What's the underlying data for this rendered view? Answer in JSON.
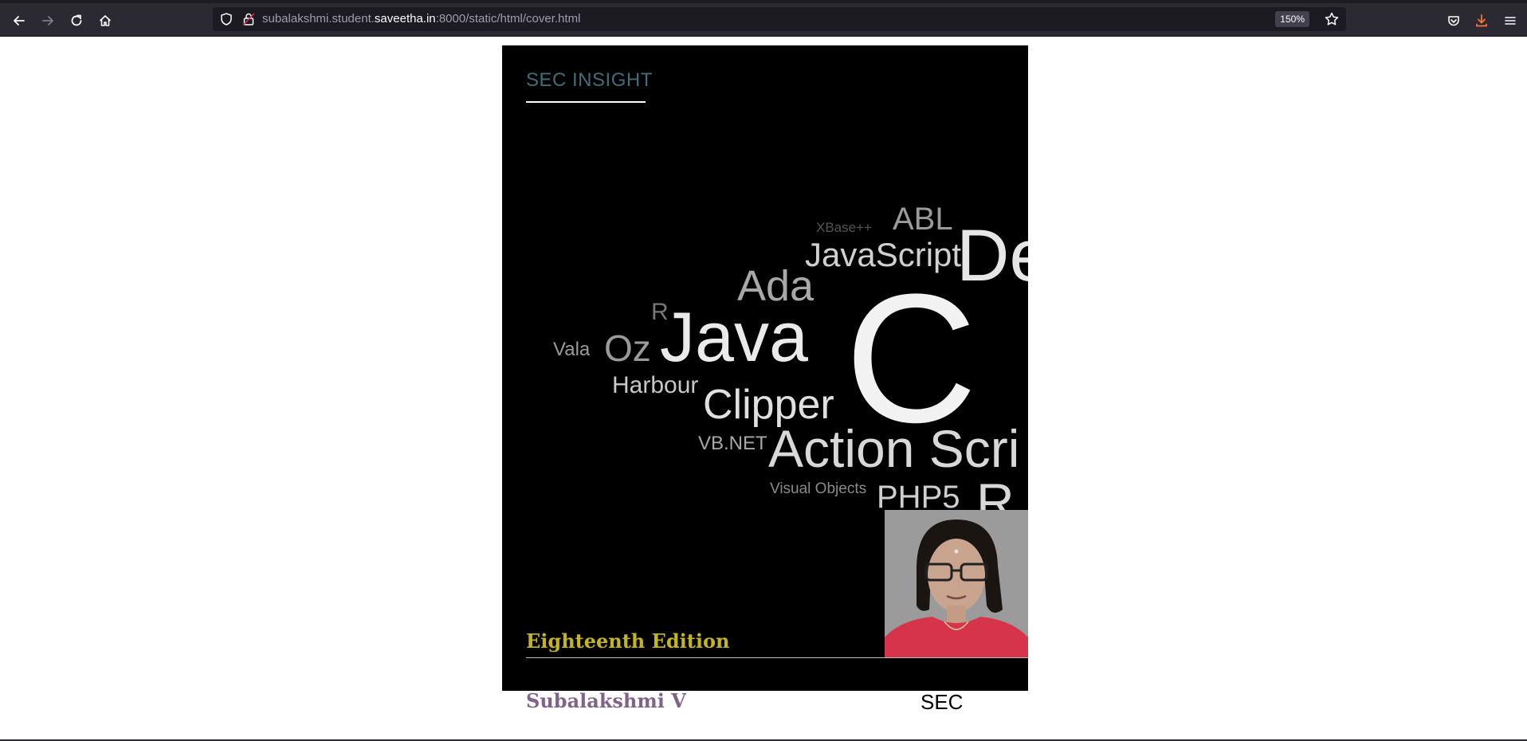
{
  "browser": {
    "url_prefix": "subalakshmi.student.",
    "url_domain": "saveetha.in",
    "url_suffix": ":8000/static/html/cover.html",
    "zoom": "150%",
    "icons": [
      "back-arrow-icon",
      "forward-arrow-icon",
      "reload-icon",
      "home-icon",
      "shield-icon",
      "lock-icon",
      "bookmark-star-icon",
      "pocket-icon",
      "downloads-icon",
      "menu-icon"
    ],
    "colors": {
      "toolbar": "#2b2a33",
      "urlbar": "#1c1b22",
      "download_accent": "#ff7139"
    }
  },
  "cover": {
    "brand": "SEC INSIGHT",
    "edition": "Eighteenth Edition",
    "author": "Subalakshmi V",
    "org": "SEC",
    "word_cloud": [
      "XBase++",
      "ABL",
      "JavaScript",
      "De",
      "Ada",
      "R",
      "Java",
      "C",
      "Vala",
      "Oz",
      "Harbour",
      "Clipper",
      "VB.NET",
      "Action Scri",
      "Visual Objects",
      "PHP5",
      "R"
    ],
    "colors": {
      "background": "#000000",
      "brand": "#3f6e78",
      "edition": "#c4b51d",
      "author": "#80628a"
    }
  }
}
